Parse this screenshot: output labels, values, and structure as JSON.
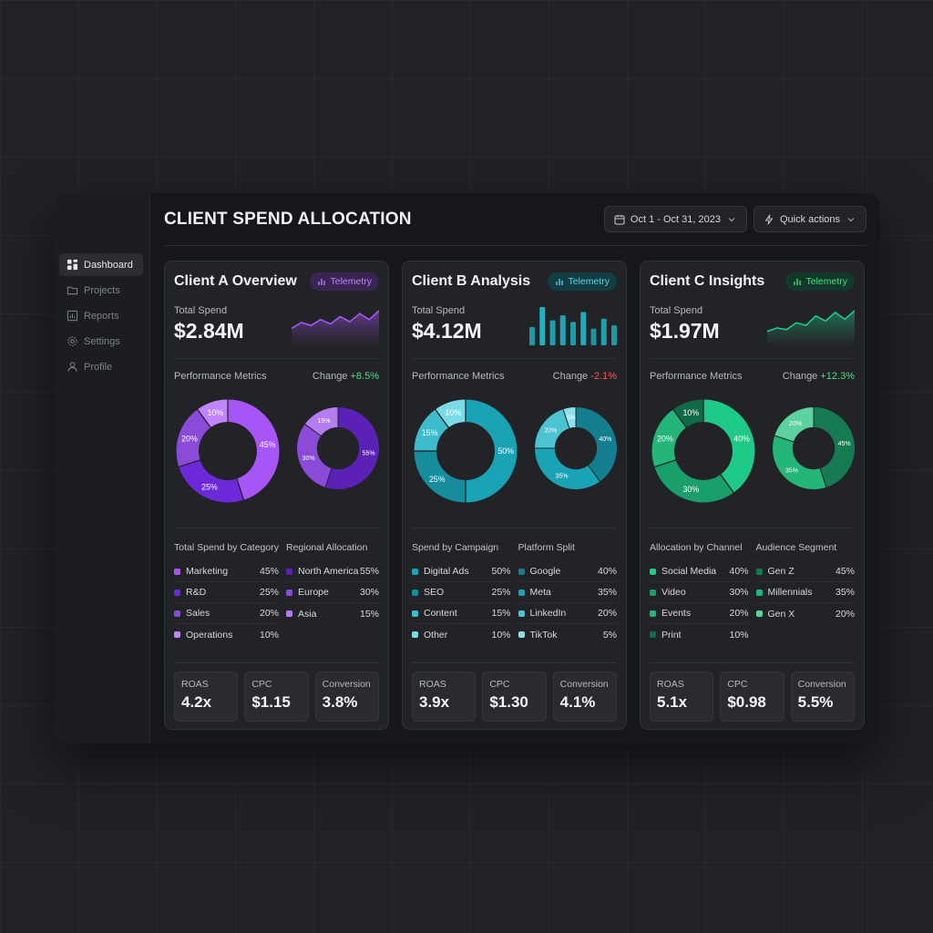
{
  "sidebar": {
    "items": [
      {
        "label": "Dashboard",
        "icon": "grid-icon",
        "active": true
      },
      {
        "label": "Projects",
        "icon": "folder-icon"
      },
      {
        "label": "Reports",
        "icon": "bar-chart-icon"
      },
      {
        "label": "Settings",
        "icon": "gear-icon"
      },
      {
        "label": "Profile",
        "icon": "user-icon"
      }
    ]
  },
  "header": {
    "title": "CLIENT SPEND ALLOCATION",
    "date_range": "Oct 1 - Oct 31, 2023",
    "quick_actions": "Quick actions"
  },
  "cards": [
    {
      "title": "Client A Overview",
      "badge": "Telemetry",
      "spend_label": "Total Spend",
      "spend_value": "$2.84M",
      "metrics_label": "Performance Metrics",
      "change_label": "Change",
      "change_value": "+8.5%",
      "left_title": "Total Spend by Category",
      "left_rows": [
        {
          "label": "Marketing",
          "pct": "45%"
        },
        {
          "label": "R&D",
          "pct": "25%"
        },
        {
          "label": "Sales",
          "pct": "20%"
        },
        {
          "label": "Operations",
          "pct": "10%"
        }
      ],
      "right_title": "Regional Allocation",
      "right_rows": [
        {
          "label": "North America",
          "pct": "55%"
        },
        {
          "label": "Europe",
          "pct": "30%"
        },
        {
          "label": "Asia",
          "pct": "15%"
        }
      ],
      "kpis": [
        {
          "label": "ROAS",
          "value": "4.2x"
        },
        {
          "label": "CPC",
          "value": "$1.15"
        },
        {
          "label": "Conversion",
          "value": "3.8%"
        }
      ]
    },
    {
      "title": "Client B Analysis",
      "badge": "Telemetry",
      "spend_label": "Total Spend",
      "spend_value": "$4.12M",
      "metrics_label": "Performance Metrics",
      "change_label": "Change",
      "change_value": "-2.1%",
      "left_title": "Spend by Campaign",
      "left_rows": [
        {
          "label": "Digital Ads",
          "pct": "50%"
        },
        {
          "label": "SEO",
          "pct": "25%"
        },
        {
          "label": "Content",
          "pct": "15%"
        },
        {
          "label": "Other",
          "pct": "10%"
        }
      ],
      "right_title": "Platform Split",
      "right_rows": [
        {
          "label": "Google",
          "pct": "40%"
        },
        {
          "label": "Meta",
          "pct": "35%"
        },
        {
          "label": "LinkedIn",
          "pct": "20%"
        },
        {
          "label": "TikTok",
          "pct": "5%"
        }
      ],
      "kpis": [
        {
          "label": "ROAS",
          "value": "3.9x"
        },
        {
          "label": "CPC",
          "value": "$1.30"
        },
        {
          "label": "Conversion",
          "value": "4.1%"
        }
      ]
    },
    {
      "title": "Client C Insights",
      "badge": "Telemetry",
      "spend_label": "Total Spend",
      "spend_value": "$1.97M",
      "metrics_label": "Performance Metrics",
      "change_label": "Change",
      "change_value": "+12.3%",
      "left_title": "Allocation by Channel",
      "left_rows": [
        {
          "label": "Social Media",
          "pct": "40%"
        },
        {
          "label": "Video",
          "pct": "30%"
        },
        {
          "label": "Events",
          "pct": "20%"
        },
        {
          "label": "Print",
          "pct": "10%"
        }
      ],
      "right_title": "Audience Segment",
      "right_rows": [
        {
          "label": "Gen Z",
          "pct": "45%"
        },
        {
          "label": "Millennials",
          "pct": "35%"
        },
        {
          "label": "Gen X",
          "pct": "20%"
        }
      ],
      "kpis": [
        {
          "label": "ROAS",
          "value": "5.1x"
        },
        {
          "label": "CPC",
          "value": "$0.98"
        },
        {
          "label": "Conversion",
          "value": "5.5%"
        }
      ]
    }
  ],
  "colors": {
    "positive": "#4ade80",
    "negative": "#f05d5d",
    "purple": [
      "#a855f7",
      "#6d28d9",
      "#8b4bd8",
      "#c084fc"
    ],
    "purple_small": [
      "#5b21b6",
      "#8b4bd8",
      "#b57cf0"
    ],
    "teal": [
      "#1aa3b5",
      "#168c9c",
      "#3cbccc",
      "#7adbe6"
    ],
    "teal_small": [
      "#137f8e",
      "#1aa3b5",
      "#4cc3d2",
      "#8ae1ea"
    ],
    "green": [
      "#1fc987",
      "#1a9f6a",
      "#23b678",
      "#0f6b47"
    ],
    "green_small": [
      "#157a52",
      "#23b678",
      "#5cd39e"
    ],
    "badge_bg": [
      "#3a2452",
      "#133d44",
      "#123a2b"
    ],
    "badge_fg": [
      "#c084fc",
      "#5fd6e2",
      "#4ade80"
    ]
  },
  "chart_data": [
    {
      "type": "pie",
      "categories": [
        "Marketing",
        "R&D",
        "Sales",
        "Operations"
      ],
      "values": [
        45,
        25,
        20,
        10
      ],
      "title": ""
    },
    {
      "type": "pie",
      "categories": [
        "North America",
        "Europe",
        "Asia"
      ],
      "values": [
        55,
        30,
        15
      ],
      "title": ""
    },
    {
      "type": "pie",
      "categories": [
        "Digital Ads",
        "SEO",
        "Content",
        "Other"
      ],
      "values": [
        50,
        25,
        15,
        10
      ],
      "title": ""
    },
    {
      "type": "pie",
      "categories": [
        "Google",
        "Meta",
        "LinkedIn",
        "TikTok"
      ],
      "values": [
        40,
        35,
        20,
        5
      ],
      "title": ""
    },
    {
      "type": "pie",
      "categories": [
        "Social Media",
        "Video",
        "Events",
        "Print"
      ],
      "values": [
        40,
        30,
        20,
        10
      ],
      "title": ""
    },
    {
      "type": "pie",
      "categories": [
        "Gen Z",
        "Millennials",
        "Gen X"
      ],
      "values": [
        45,
        35,
        20
      ],
      "title": ""
    },
    {
      "type": "area",
      "values": [
        18,
        26,
        22,
        30,
        24,
        34,
        27,
        38,
        30,
        42
      ],
      "title": ""
    },
    {
      "type": "bar",
      "values": [
        22,
        46,
        30,
        36,
        28,
        40,
        20,
        32,
        24
      ],
      "title": ""
    },
    {
      "type": "area",
      "values": [
        12,
        16,
        14,
        22,
        19,
        30,
        24,
        34,
        26,
        36
      ],
      "title": ""
    }
  ]
}
